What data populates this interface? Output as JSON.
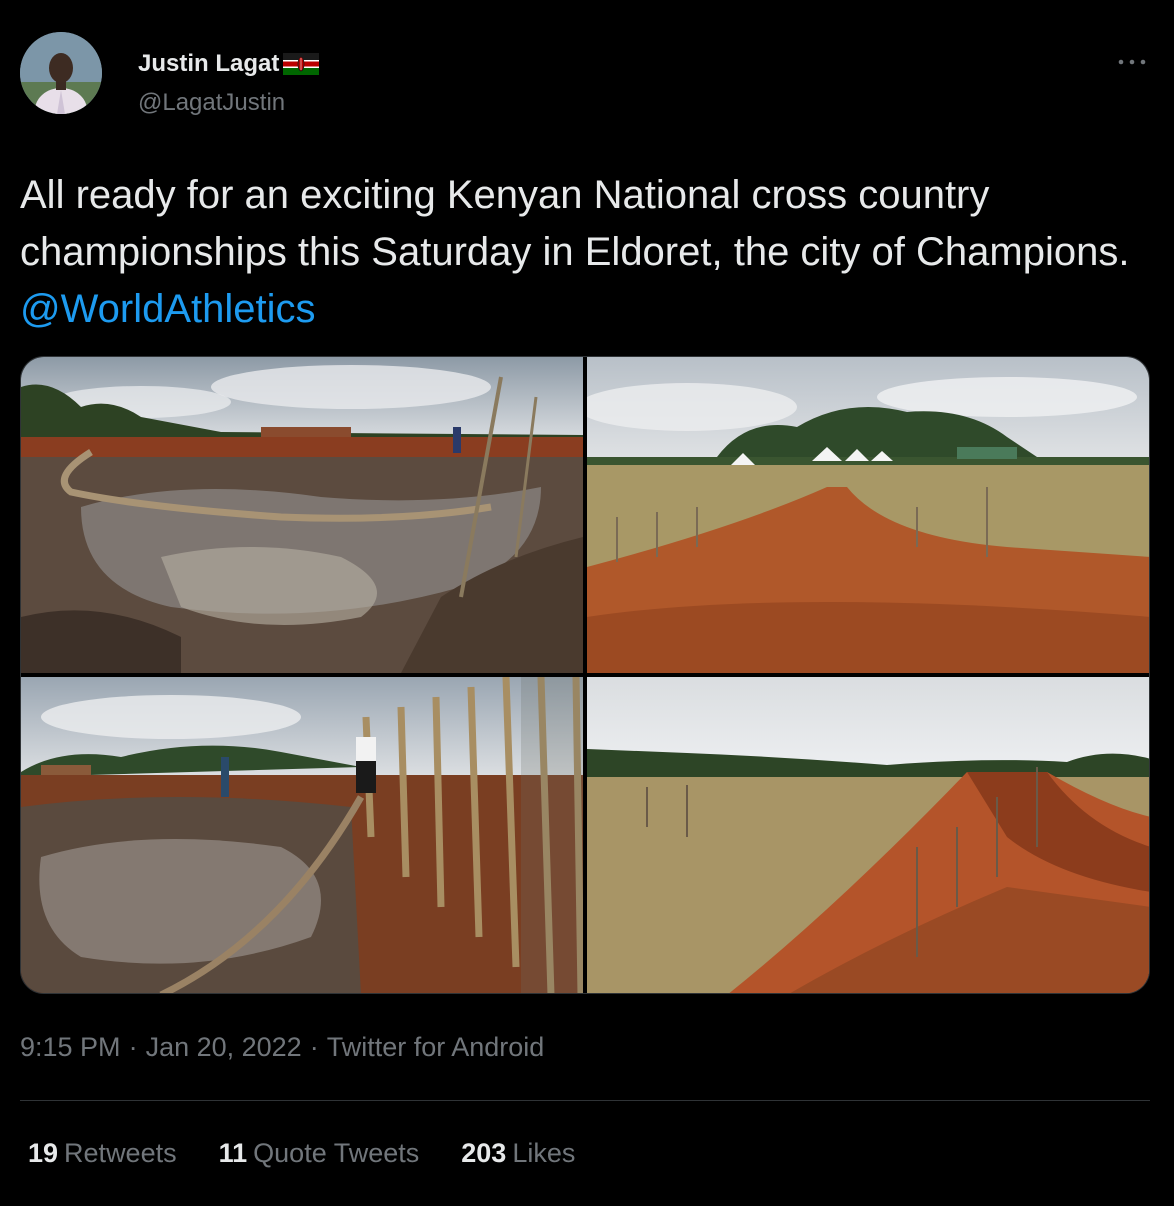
{
  "author": {
    "display_name": "Justin Lagat",
    "handle": "@LagatJustin",
    "flag_icon": "kenya-flag-icon"
  },
  "tweet": {
    "text": "All ready for an exciting Kenyan National cross country championships this Saturday in Eldoret, the city of Champions. ",
    "mention": "@WorldAthletics"
  },
  "meta": {
    "time": "9:15 PM",
    "separator": "·",
    "date": "Jan 20, 2022",
    "source": "Twitter for Android"
  },
  "stats": {
    "retweets_count": "19",
    "retweets_label": "Retweets",
    "quotes_count": "11",
    "quotes_label": "Quote Tweets",
    "likes_count": "203",
    "likes_label": "Likes"
  },
  "colors": {
    "background": "#000000",
    "text": "#e7e9ea",
    "secondary": "#71767b",
    "accent": "#1d9bf0"
  }
}
